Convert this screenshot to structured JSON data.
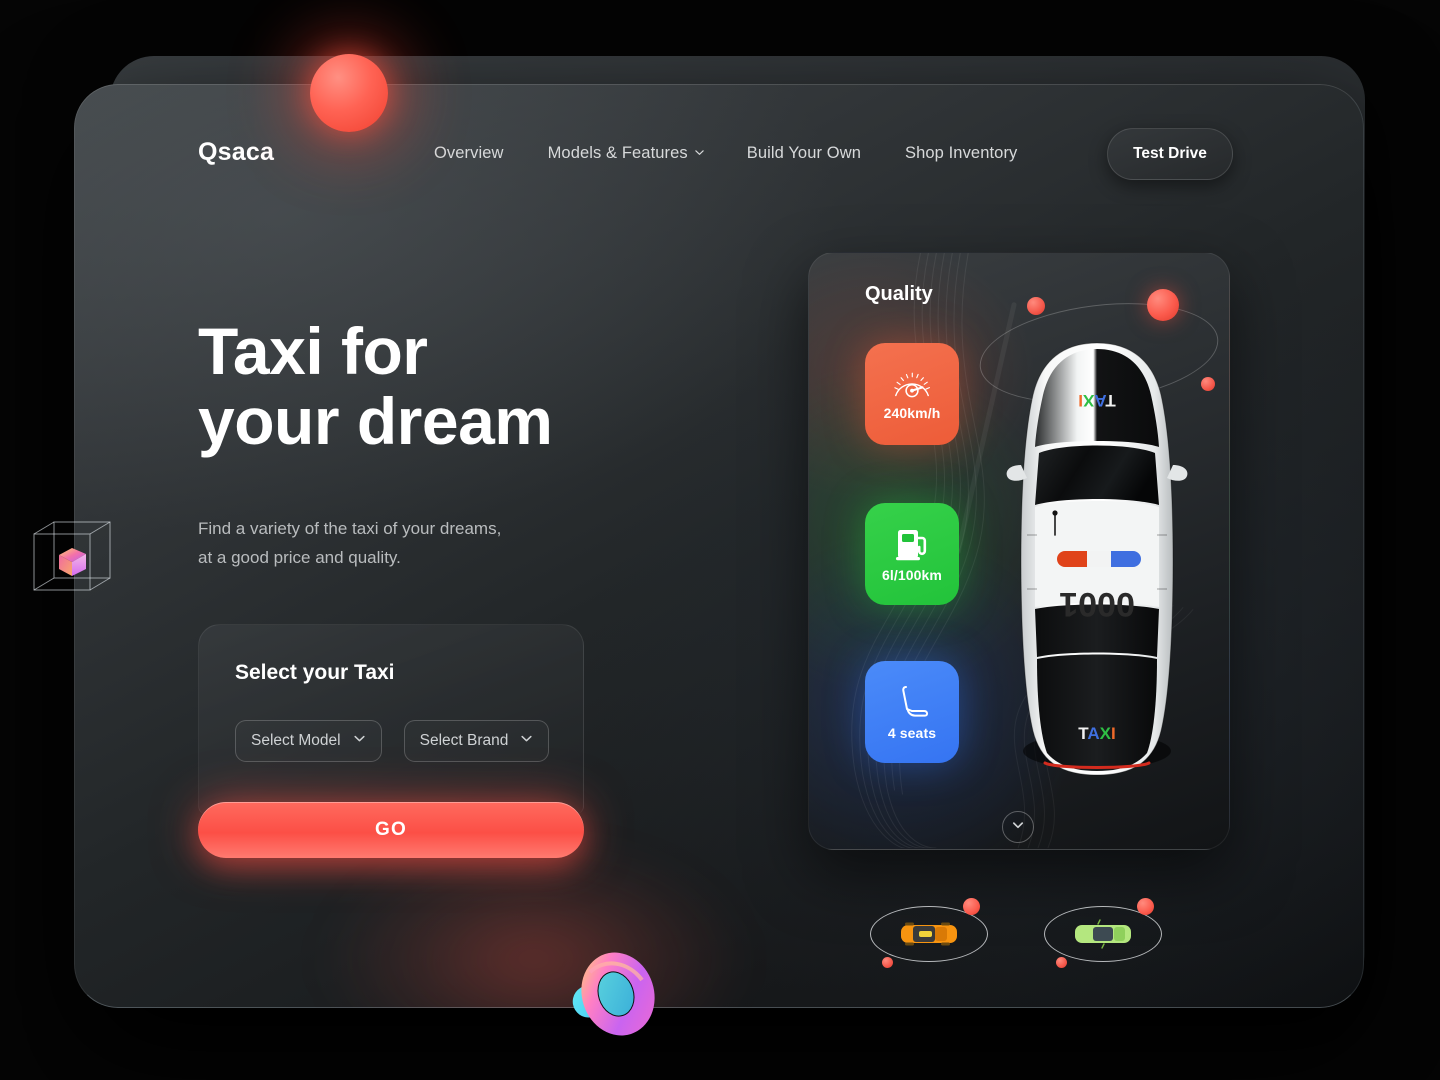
{
  "brand": {
    "name": "Qsaca"
  },
  "nav": {
    "items": [
      {
        "label": "Overview",
        "has_caret": false,
        "icon": ""
      },
      {
        "label": "Models & Features",
        "has_caret": true,
        "icon": "chevron-down-icon"
      },
      {
        "label": "Build Your Own",
        "has_caret": false,
        "icon": ""
      },
      {
        "label": "Shop Inventory",
        "has_caret": false,
        "icon": ""
      }
    ],
    "cta": {
      "label": "Test Drive"
    }
  },
  "hero": {
    "title_line1": "Taxi for",
    "title_line2": "your dream",
    "subtitle_line1": "Find a variety of the taxi of your dreams,",
    "subtitle_line2": "at a good price and quality."
  },
  "select_card": {
    "title": "Select your Taxi",
    "model_dropdown": {
      "value": "Select Model",
      "icon": "chevron-down-icon"
    },
    "brand_dropdown": {
      "value": "Select Brand",
      "icon": "chevron-down-icon"
    },
    "go_button": "GO"
  },
  "quality": {
    "title": "Quality",
    "cards": [
      {
        "label": "240km/h",
        "icon": "speedometer-icon",
        "color": "#ED5C38"
      },
      {
        "label": "6l/100km",
        "icon": "fuel-pump-icon",
        "color": "#22C33A"
      },
      {
        "label": "4 seats",
        "icon": "car-seat-icon",
        "color": "#3574F2"
      }
    ],
    "car": {
      "roof_label": "TAXI",
      "number": "0001",
      "trunk_label": "TAXI"
    },
    "expand_icon": "chevron-down-icon"
  },
  "thumbnails": [
    {
      "name": "orange-taxi-thumbnail",
      "color": "#F59E0B"
    },
    {
      "name": "green-taxi-thumbnail",
      "color": "#A8E063"
    }
  ],
  "decor": {
    "sphere": "red-glowing-sphere",
    "cube": "wireframe-cube-with-gradient-cube",
    "torus": "gradient-torus-object"
  },
  "colors": {
    "accent_red": "#FC4F46",
    "orange": "#ED5C38",
    "green": "#22C33A",
    "blue": "#3574F2",
    "panel_dark": "#1C1F22"
  }
}
